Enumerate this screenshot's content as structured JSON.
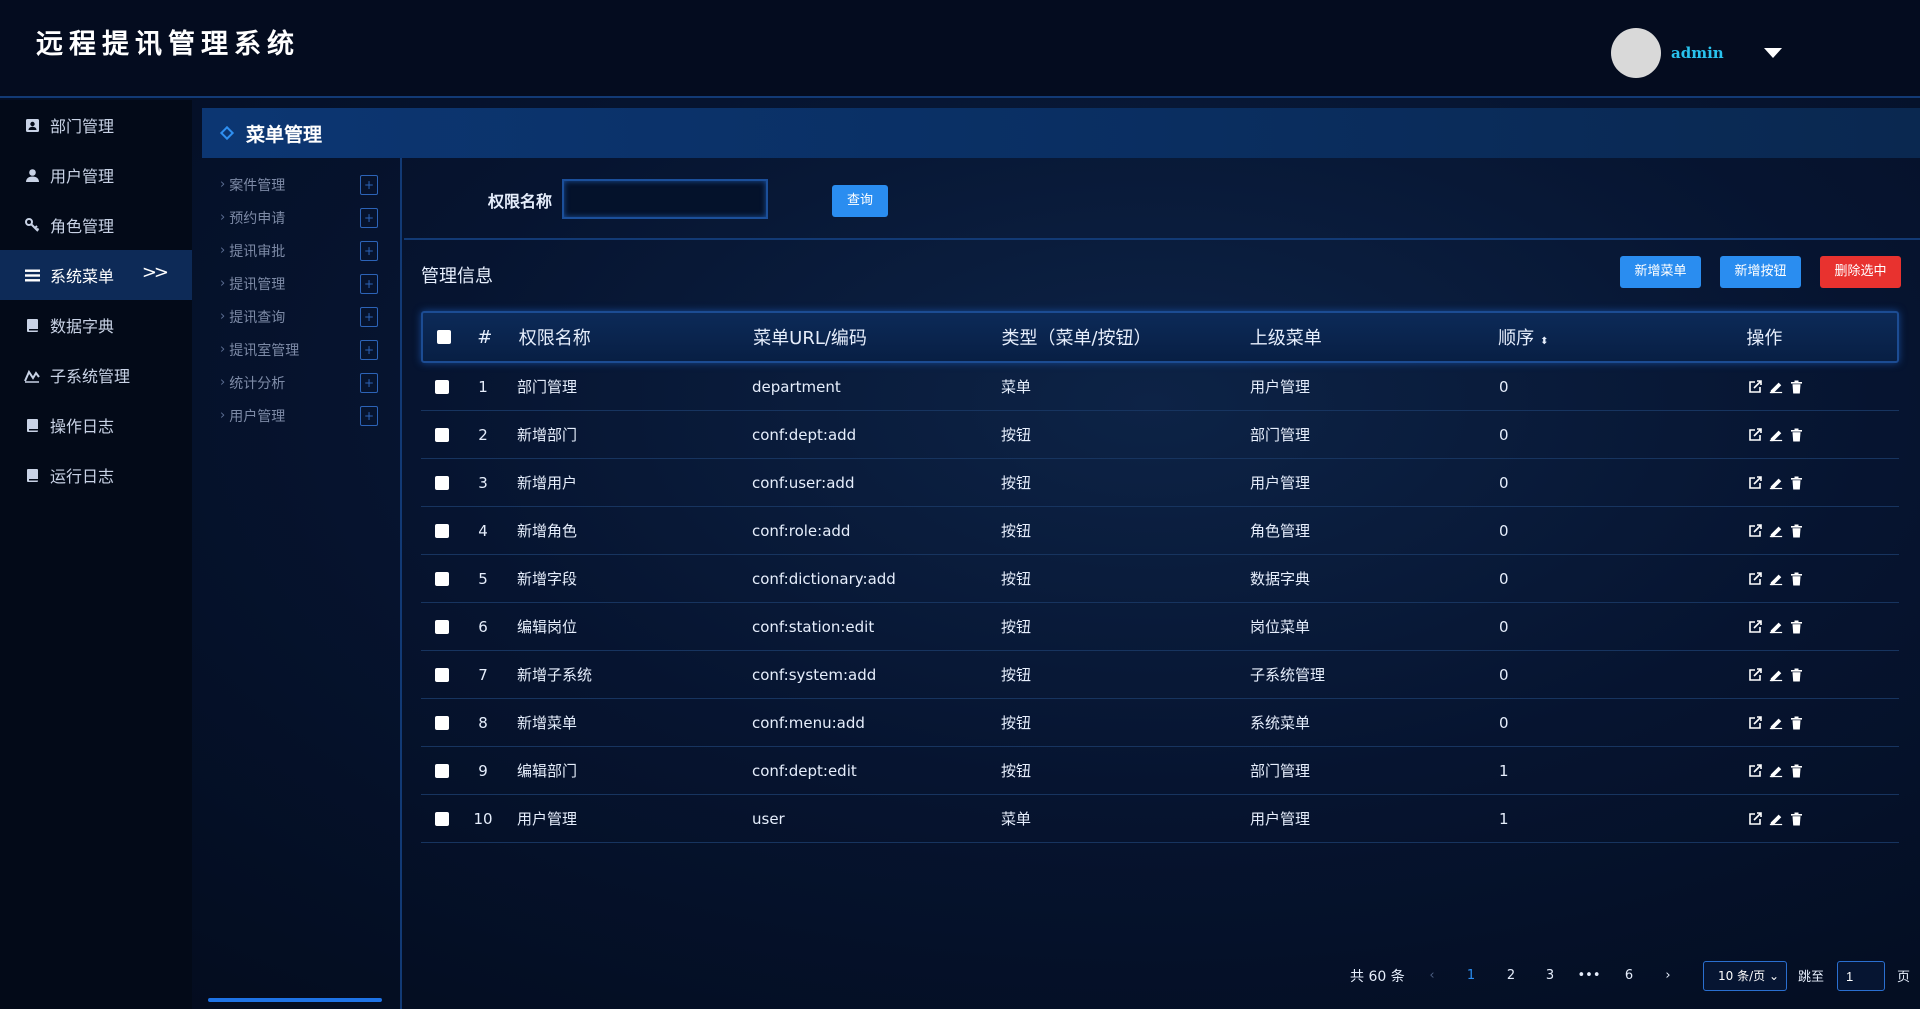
{
  "app": {
    "title": "远程提讯管理系统"
  },
  "user": {
    "name": "admin"
  },
  "sidebar": {
    "items": [
      {
        "label": "部门管理",
        "icon": "contact-card-icon"
      },
      {
        "label": "用户管理",
        "icon": "user-icon"
      },
      {
        "label": "角色管理",
        "icon": "key-icon"
      },
      {
        "label": "系统菜单",
        "icon": "list-icon",
        "active": true
      },
      {
        "label": "数据字典",
        "icon": "book-icon"
      },
      {
        "label": "子系统管理",
        "icon": "chart-line-icon"
      },
      {
        "label": "操作日志",
        "icon": "book-icon"
      },
      {
        "label": "运行日志",
        "icon": "book-icon"
      }
    ],
    "collapse_glyph": ">>"
  },
  "section": {
    "title": "菜单管理"
  },
  "submenu": {
    "items": [
      "案件管理",
      "预约申请",
      "提讯审批",
      "提讯管理",
      "提讯查询",
      "提讯室管理",
      "统计分析",
      "用户管理"
    ],
    "plus_glyph": "+"
  },
  "search": {
    "label": "权限名称",
    "value": "",
    "button": "查询"
  },
  "mgmt": {
    "title": "管理信息",
    "add_menu": "新增菜单",
    "add_button": "新增按钮",
    "delete_selected": "删除选中"
  },
  "table": {
    "headers": {
      "num": "#",
      "name": "权限名称",
      "url": "菜单URL/编码",
      "type": "类型（菜单/按钮）",
      "parent": "上级菜单",
      "order": "顺序",
      "ops": "操作"
    },
    "rows": [
      {
        "num": "1",
        "name": "部门管理",
        "url": "department",
        "type": "菜单",
        "parent": "用户管理",
        "order": "0"
      },
      {
        "num": "2",
        "name": "新增部门",
        "url": "conf:dept:add",
        "type": "按钮",
        "parent": "部门管理",
        "order": "0"
      },
      {
        "num": "3",
        "name": "新增用户",
        "url": "conf:user:add",
        "type": "按钮",
        "parent": "用户管理",
        "order": "0"
      },
      {
        "num": "4",
        "name": "新增角色",
        "url": "conf:role:add",
        "type": "按钮",
        "parent": "角色管理",
        "order": "0"
      },
      {
        "num": "5",
        "name": "新增字段",
        "url": "conf:dictionary:add",
        "type": "按钮",
        "parent": "数据字典",
        "order": "0"
      },
      {
        "num": "6",
        "name": "编辑岗位",
        "url": "conf:station:edit",
        "type": "按钮",
        "parent": "岗位菜单",
        "order": "0"
      },
      {
        "num": "7",
        "name": "新增子系统",
        "url": "conf:system:add",
        "type": "按钮",
        "parent": "子系统管理",
        "order": "0"
      },
      {
        "num": "8",
        "name": "新增菜单",
        "url": "conf:menu:add",
        "type": "按钮",
        "parent": "系统菜单",
        "order": "0"
      },
      {
        "num": "9",
        "name": "编辑部门",
        "url": "conf:dept:edit",
        "type": "按钮",
        "parent": "部门管理",
        "order": "1"
      },
      {
        "num": "10",
        "name": "用户管理",
        "url": "user",
        "type": "菜单",
        "parent": "用户管理",
        "order": "1"
      }
    ]
  },
  "pagination": {
    "total": "共 60 条",
    "prev": "‹",
    "pages": [
      "1",
      "2",
      "3",
      "•••",
      "6"
    ],
    "current": "1",
    "next": "›",
    "page_size": "10 条/页",
    "jump_label": "跳至",
    "jump_value": "1",
    "page_suffix": "页"
  },
  "colors": {
    "accent": "#2a8df0",
    "danger": "#e8322f",
    "brand_user": "#29c3ee"
  }
}
